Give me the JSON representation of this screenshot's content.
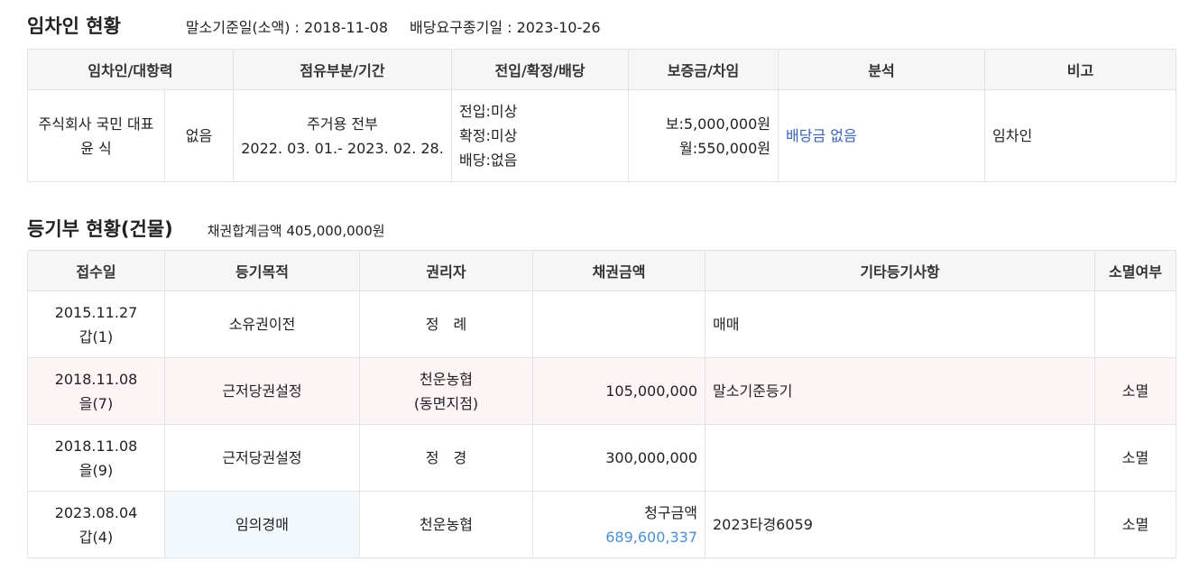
{
  "tenant_section": {
    "title": "임차인 현황",
    "malso_date": "말소기준일(소액) : 2018-11-08",
    "dividend_deadline": "배당요구종기일 : 2023-10-26",
    "headers": [
      "임차인/대항력",
      "점유부분/기간",
      "전입/확정/배당",
      "보증금/차임",
      "분석",
      "비고"
    ],
    "row": {
      "tenant_name": "주식회사 국민 대표 윤 식",
      "opposing_power": "없음",
      "occupancy_part": "주거용 전부",
      "occupancy_period": "2022. 03. 01.- 2023. 02. 28.",
      "move_in": "전입:미상",
      "confirm": "확정:미상",
      "dividend": "배당:없음",
      "deposit": "보:5,000,000원",
      "rent": "월:550,000원",
      "analysis": "배당금 없음",
      "note": "임차인"
    }
  },
  "registry_section": {
    "title": "등기부 현황(건물)",
    "total_claim": "채권합계금액 405,000,000원",
    "headers": [
      "접수일",
      "등기목적",
      "권리자",
      "채권금액",
      "기타등기사항",
      "소멸여부"
    ],
    "rows": [
      {
        "date": "2015.11.27",
        "rank": "갑(1)",
        "purpose": "소유권이전",
        "holder": "정　례",
        "holder2": "",
        "amount_label": "",
        "amount": "",
        "etc": "매매",
        "extinct": ""
      },
      {
        "date": "2018.11.08",
        "rank": "을(7)",
        "purpose": "근저당권설정",
        "holder": "천운농협",
        "holder2": "(동면지점)",
        "amount_label": "",
        "amount": "105,000,000",
        "etc": "말소기준등기",
        "extinct": "소멸"
      },
      {
        "date": "2018.11.08",
        "rank": "을(9)",
        "purpose": "근저당권설정",
        "holder": "정　경",
        "holder2": "",
        "amount_label": "",
        "amount": "300,000,000",
        "etc": "",
        "extinct": "소멸"
      },
      {
        "date": "2023.08.04",
        "rank": "갑(4)",
        "purpose": "임의경매",
        "holder": "천운농협",
        "holder2": "",
        "amount_label": "청구금액",
        "amount": "689,600,337",
        "etc": "2023타경6059",
        "extinct": "소멸"
      }
    ]
  },
  "colors": {
    "header_bg": "#f6f6f6",
    "border": "#e3e3e3",
    "analysis_blue": "#3b63b3",
    "claim_blue": "#4a90d9",
    "highlight_row": "#fdf5f5",
    "highlight_cell": "#f3f8fd"
  }
}
